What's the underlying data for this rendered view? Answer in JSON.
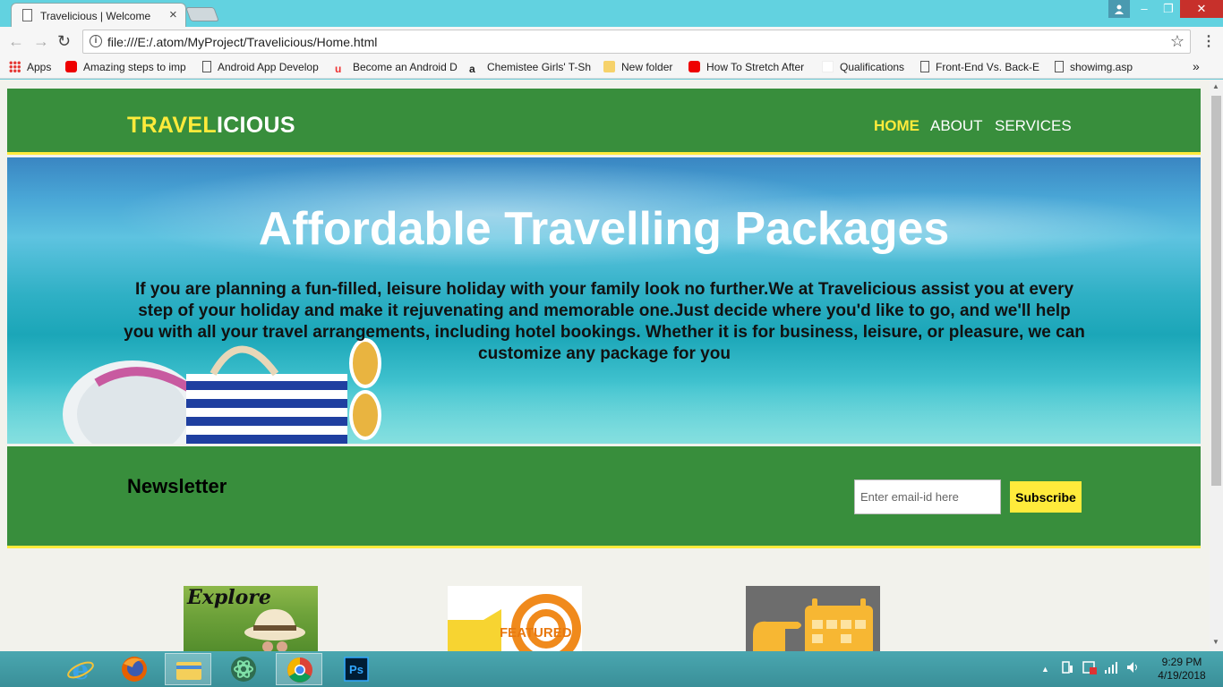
{
  "browser": {
    "tab_title": "Travelicious | Welcome",
    "tab_close": "×",
    "url": "file:///E:/.atom/MyProject/Travelicious/Home.html",
    "window_controls": [
      "–",
      "❐",
      "✕"
    ],
    "nav_icons": [
      "back-icon",
      "forward-icon",
      "reload-icon"
    ],
    "bookmarks": [
      {
        "label": "Apps",
        "icon": "apps-grid-icon"
      },
      {
        "label": "Amazing steps to imp",
        "icon": "youtube-icon"
      },
      {
        "label": "Android App Develop",
        "icon": "page-icon"
      },
      {
        "label": "Become an Android D",
        "icon": "udacity-icon"
      },
      {
        "label": "Chemistee Girls' T-Sh",
        "icon": "amazon-icon"
      },
      {
        "label": "New folder",
        "icon": "folder-icon"
      },
      {
        "label": "How To Stretch After",
        "icon": "youtube-icon"
      },
      {
        "label": "Qualifications",
        "icon": "blank-page-icon"
      },
      {
        "label": "Front-End Vs. Back-E",
        "icon": "page-icon"
      },
      {
        "label": "showimg.asp",
        "icon": "page-icon"
      }
    ],
    "bookmarks_overflow": "»"
  },
  "site": {
    "logo_highlight": "TRAVEL",
    "logo_rest": "ICIOUS",
    "nav": [
      "HOME",
      "ABOUT",
      "SERVICES"
    ],
    "active_nav": "HOME",
    "colors": {
      "primary": "#388e3c",
      "accent": "#ffeb3b"
    }
  },
  "hero": {
    "title": "Affordable Travelling Packages",
    "text": "If you are planning a fun-filled, leisure holiday with your family look no further.We at Travelicious assist you at every step of your holiday and make it rejuvenating and memorable one.Just decide where you'd like to go, and we'll help you with all your travel arrangements, including hotel bookings. Whether it is for business, leisure, or pleasure, we can customize any package for you"
  },
  "newsletter": {
    "heading": "Newsletter",
    "email_placeholder": "Enter email-id here",
    "email_value": "",
    "button": "Subscribe"
  },
  "cards": [
    {
      "image_text": "Explore",
      "icon": "explorer-hat-image"
    },
    {
      "image_text": "FEATURED",
      "icon": "megaphone-featured-image"
    },
    {
      "image_text": "",
      "icon": "hand-calendar-image"
    }
  ],
  "taskbar": {
    "apps": [
      "internet-explorer-icon",
      "firefox-icon",
      "file-explorer-icon",
      "atom-icon",
      "chrome-icon",
      "photoshop-icon"
    ],
    "photoshop_label": "Ps",
    "tray_arrow": "▲",
    "time": "9:29 PM",
    "date": "4/19/2018"
  }
}
